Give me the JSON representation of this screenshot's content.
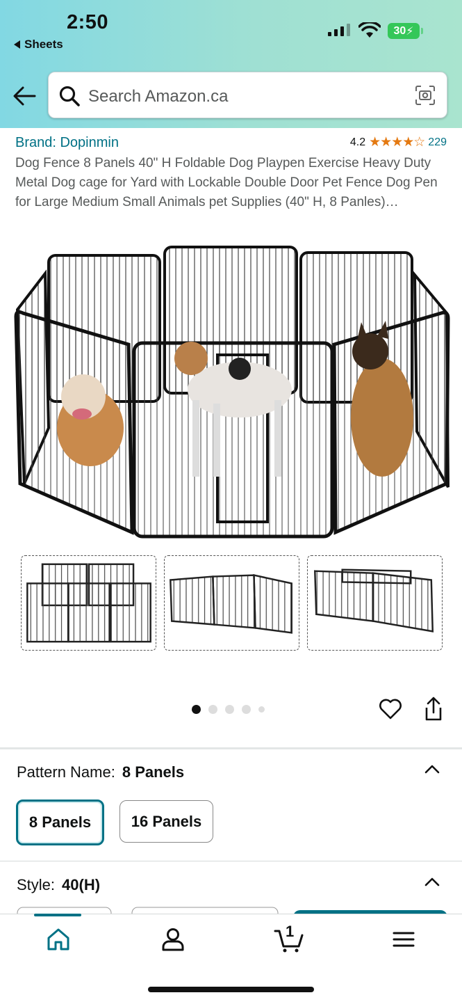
{
  "status_bar": {
    "time": "2:50",
    "back_app": "Sheets",
    "battery": "30"
  },
  "search": {
    "placeholder": "Search Amazon.ca"
  },
  "product": {
    "brand": "Brand: Dopinmin",
    "rating": "4.2",
    "stars": "★★★★☆",
    "review_count": "229",
    "title": "Dog Fence 8 Panels 40\" H Foldable Dog Playpen Exercise Heavy Duty Metal Dog cage for Yard with Lockable Double Door Pet Fence Dog Pen for Large Medium Small Animals pet Supplies (40\" H, 8 Panles)…"
  },
  "gallery": {
    "image_count": 5,
    "active_index": 0
  },
  "pattern": {
    "label": "Pattern Name:",
    "value": "8 Panels",
    "options": [
      "8 Panels",
      "16 Panels"
    ],
    "selected": "8 Panels"
  },
  "style": {
    "label": "Style:",
    "value": "40(H)"
  },
  "bottom_nav": {
    "items": [
      "home-icon",
      "account-icon",
      "cart-icon",
      "menu-icon"
    ],
    "cart_count": "1",
    "accent": "#007185"
  },
  "colors": {
    "link": "#007185",
    "star": "#e47911",
    "selected_border": "#007185"
  }
}
